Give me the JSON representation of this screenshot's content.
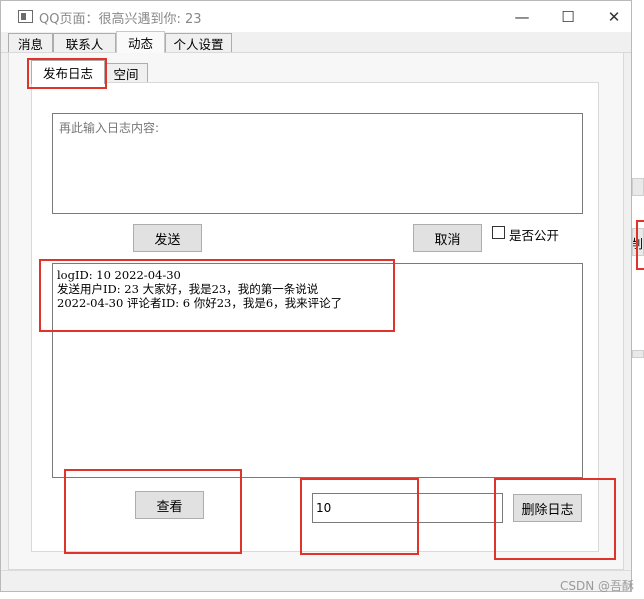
{
  "window": {
    "title": "QQ页面：很高兴遇到你: 23"
  },
  "title_buttons": {
    "minimize": "—",
    "maximize": "☐",
    "close": "✕"
  },
  "main_tabs": [
    {
      "label": "消息"
    },
    {
      "label": "联系人"
    },
    {
      "label": "动态"
    },
    {
      "label": "个人设置"
    }
  ],
  "sub_tabs": [
    {
      "label": "发布日志"
    },
    {
      "label": "空间"
    }
  ],
  "post": {
    "placeholder": "再此输入日志内容:",
    "send_label": "发送",
    "cancel_label": "取消",
    "public_label": "是否公开"
  },
  "log": {
    "lines": [
      "logID: 10 2022-04-30",
      "发送用户ID: 23 大家好，我是23，我的第一条说说",
      "2022-04-30 评论者ID:  6 你好23，我是6，我来评论了"
    ]
  },
  "actions": {
    "view_label": "查看",
    "id_value": "10",
    "delete_label": "删除日志"
  },
  "behind_window": {
    "fragment": "削"
  },
  "watermark": "CSDN @吾酥",
  "colors": {
    "annotation_red": "#e0342a",
    "background": "#f0f0f0"
  }
}
